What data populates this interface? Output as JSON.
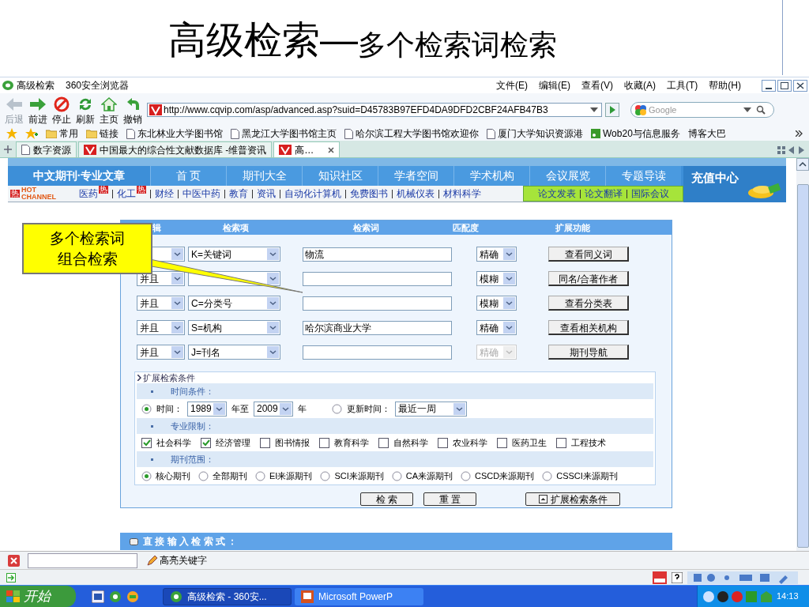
{
  "slide": {
    "title": "高级检索—",
    "subtitle": "多个检索词检索"
  },
  "browser": {
    "title": "高级检索",
    "app": "360安全浏览器",
    "menu": [
      "文件(E)",
      "编辑(E)",
      "查看(V)",
      "收藏(A)",
      "工具(T)",
      "帮助(H)"
    ],
    "toolbar": [
      {
        "label": "后退",
        "kind": "back",
        "disabled": true
      },
      {
        "label": "前进",
        "kind": "forward",
        "disabled": false
      },
      {
        "label": "停止",
        "kind": "stop",
        "disabled": false
      },
      {
        "label": "刷新",
        "kind": "refresh",
        "disabled": false
      },
      {
        "label": "主页",
        "kind": "home",
        "disabled": false
      },
      {
        "label": "撤销",
        "kind": "undo",
        "disabled": false
      }
    ],
    "address": "http://www.cqvip.com/asp/advanced.asp?suid=D45783B97EFD4DA9DFD2CBF24AFB47B3",
    "search": {
      "placeholder": "Google"
    },
    "bookmarks": [
      {
        "label": "常用",
        "kind": "folder"
      },
      {
        "label": "链接",
        "kind": "folder"
      },
      {
        "label": "东北林业大学图书馆",
        "kind": "page"
      },
      {
        "label": "黑龙江大学图书馆主页",
        "kind": "page"
      },
      {
        "label": "哈尔滨工程大学图书馆欢迎你",
        "kind": "page"
      },
      {
        "label": "厦门大学知识资源港",
        "kind": "page"
      },
      {
        "label": "Wob20与信息服务",
        "kind": "feed"
      },
      {
        "label": "博客大巴",
        "kind": "text"
      }
    ],
    "tabs": [
      {
        "label": "数字资源",
        "kind": "page",
        "selected": false
      },
      {
        "label": "中国最大的综合性文献数据库 -维普资讯",
        "kind": "site",
        "selected": false
      },
      {
        "label": "高…",
        "kind": "site",
        "selected": true
      }
    ]
  },
  "site": {
    "logo": "中文期刊·专业文章",
    "nav": [
      "首 页",
      "期刊大全",
      "知识社区",
      "学者空间",
      "学术机构",
      "会议展览",
      "专题导读"
    ],
    "promo": "充值中心",
    "hot_logo": {
      "badge": "热",
      "text": "HOT CHANNEL"
    },
    "channels": [
      {
        "label": "医药",
        "badge": "热"
      },
      {
        "label": "化工",
        "badge": "热"
      },
      {
        "label": "财经"
      },
      {
        "label": "中医中药"
      },
      {
        "label": "教育"
      },
      {
        "label": "资讯"
      },
      {
        "label": "自动化计算机"
      },
      {
        "label": "免费图书"
      },
      {
        "label": "机械仪表"
      },
      {
        "label": "材料科学"
      }
    ],
    "green_channels": [
      "论文发表",
      "论文翻译",
      "国际会议"
    ]
  },
  "form": {
    "columns": [
      "辑",
      "检索项",
      "检索词",
      "匹配度",
      "扩展功能"
    ],
    "rows": [
      {
        "field": "K=关键词",
        "term": "物流",
        "match": "精确",
        "match_disabled": false,
        "action": "查看同义词"
      },
      {
        "logic": "并且",
        "match": "模糊",
        "match_disabled": false,
        "action": "同名/合著作者"
      },
      {
        "logic": "并且",
        "field": "C=分类号",
        "match": "模糊",
        "match_disabled": false,
        "action": "查看分类表"
      },
      {
        "logic": "并且",
        "field": "S=机构",
        "term": "哈尔滨商业大学",
        "match": "精确",
        "match_disabled": false,
        "action": "查看相关机构"
      },
      {
        "logic": "并且",
        "field": "J=刊名",
        "match": "精确",
        "match_disabled": true,
        "action": "期刊导航"
      }
    ],
    "extended": {
      "toggle": "扩展检索条件",
      "time": {
        "heading": "时间条件：",
        "range": {
          "label": "时间：",
          "selected": true,
          "from": "1989",
          "between": "年至",
          "to": "2009",
          "unit": "年"
        },
        "update": {
          "label": "更新时间：",
          "selected": false,
          "value": "最近一周"
        }
      },
      "subjects": {
        "heading": "专业限制：",
        "items": [
          {
            "label": "社会科学",
            "checked": true
          },
          {
            "label": "经济管理",
            "checked": true
          },
          {
            "label": "图书情报",
            "checked": false
          },
          {
            "label": "教育科学",
            "checked": false
          },
          {
            "label": "自然科学",
            "checked": false
          },
          {
            "label": "农业科学",
            "checked": false
          },
          {
            "label": "医药卫生",
            "checked": false
          },
          {
            "label": "工程技术",
            "checked": false
          }
        ]
      },
      "scope": {
        "heading": "期刊范围：",
        "items": [
          {
            "label": "核心期刊",
            "selected": true
          },
          {
            "label": "全部期刊",
            "selected": false
          },
          {
            "label": "EI来源期刊",
            "selected": false
          },
          {
            "label": "SCI来源期刊",
            "selected": false
          },
          {
            "label": "CA来源期刊",
            "selected": false
          },
          {
            "label": "CSCD来源期刊",
            "selected": false
          },
          {
            "label": "CSSCI来源期刊",
            "selected": false
          }
        ]
      }
    },
    "buttons": [
      "检 索",
      "重 置"
    ],
    "expand_button": "扩展检索条件"
  },
  "direct_input": "直 接 输 入 检 索 式 ：",
  "callout": [
    "多个检索词",
    "组合检索"
  ],
  "findbar": {
    "highlight": "高亮关键字"
  },
  "taskbar": {
    "start": "开始",
    "tasks": [
      {
        "label": "高级检索 - 360安...",
        "kind": "browser",
        "selected": true
      },
      {
        "label": "Microsoft PowerP",
        "kind": "slides",
        "selected": false
      }
    ],
    "clock": "14:13"
  }
}
